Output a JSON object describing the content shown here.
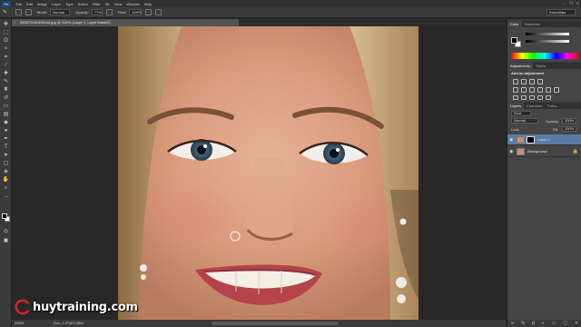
{
  "app": {
    "logo": "Ps",
    "menu": [
      "File",
      "Edit",
      "Image",
      "Layer",
      "Type",
      "Select",
      "Filter",
      "3D",
      "View",
      "Window",
      "Help"
    ],
    "window_controls": [
      "–",
      "❐",
      "✕"
    ]
  },
  "options_bar": {
    "mode_label": "Mode:",
    "mode_value": "Normal",
    "opacity_label": "Opacity:",
    "opacity_value": "77%",
    "flow_label": "Flow:",
    "flow_value": "100%",
    "workspace": "Essentials"
  },
  "document": {
    "tab_title": "390570451598148.jpg @ 200% (Layer 1, Layer Mask/8)"
  },
  "status_bar": {
    "zoom": "200%",
    "doc_info": "Doc: 1.87M/2.98M"
  },
  "watermark": {
    "brand_text": "huytraining.com"
  },
  "panels": {
    "color": {
      "tabs": [
        "Color",
        "Swatches"
      ]
    },
    "adjustments": {
      "tabs": [
        "Adjustments",
        "Styles"
      ],
      "title": "Add an adjustment"
    },
    "layers": {
      "tabs": [
        "Layers",
        "Channels",
        "Paths"
      ],
      "kind_filter": "Kind",
      "blend_mode": "Normal",
      "opacity_label": "Opacity:",
      "opacity_value": "100%",
      "lock_label": "Lock:",
      "fill_label": "Fill:",
      "fill_value": "100%",
      "items": [
        {
          "name": "Layer 1",
          "selected": true,
          "has_mask": true
        },
        {
          "name": "Background",
          "selected": false,
          "locked": true
        }
      ]
    }
  },
  "colors": {
    "accent": "#5b7ba3",
    "brand": "#1e4b73",
    "watermark_red": "#c9262b"
  }
}
